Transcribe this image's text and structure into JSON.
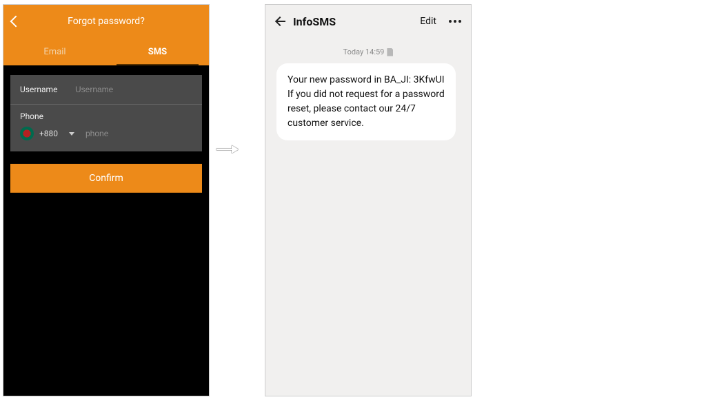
{
  "forgot": {
    "header_title": "Forgot password?",
    "tabs": {
      "email": "Email",
      "sms": "SMS"
    },
    "username_label": "Username",
    "username_placeholder": "Username",
    "phone_label": "Phone",
    "dial_code": "+880",
    "phone_placeholder": "phone",
    "confirm_label": "Confirm"
  },
  "sms": {
    "title": "InfoSMS",
    "edit_label": "Edit",
    "timestamp": "Today 14:59",
    "message": "Your new password in BA_JI: 3KfwUI  If you did not request for a password reset, please contact our 24/7 customer service."
  }
}
